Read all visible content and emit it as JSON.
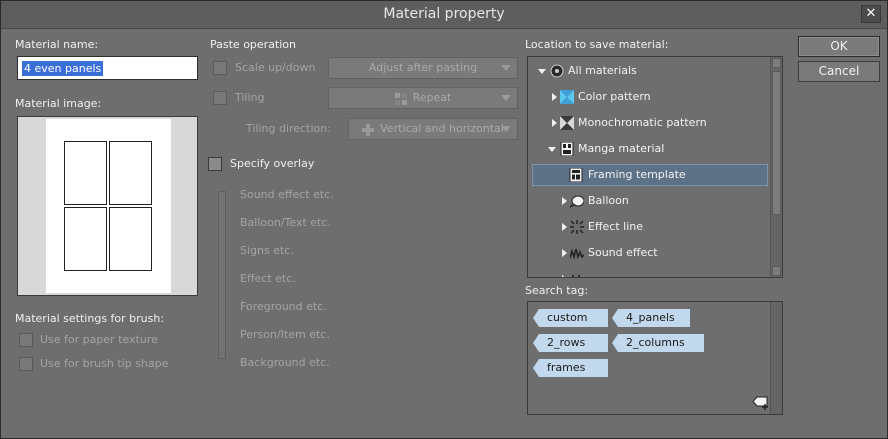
{
  "window": {
    "title": "Material property",
    "close_glyph": "✕"
  },
  "material_name": {
    "label": "Material name:",
    "value": "4 even panels"
  },
  "material_image": {
    "label": "Material image:"
  },
  "brush_settings": {
    "label": "Material settings for brush:",
    "paper_texture": "Use for paper texture",
    "brush_tip": "Use for brush tip shape"
  },
  "paste": {
    "label": "Paste operation",
    "scale_label": "Scale up/down",
    "scale_value": "Adjust after pasting",
    "tiling_label": "Tiling",
    "tiling_value": "Repeat",
    "direction_label": "Tiling direction:",
    "direction_value": "Vertical and horizontal"
  },
  "overlay": {
    "label": "Specify overlay",
    "levels": [
      "Sound effect etc.",
      "Balloon/Text etc.",
      "Signs etc.",
      "Effect etc.",
      "Foreground etc.",
      "Person/Item etc.",
      "Background etc."
    ]
  },
  "location": {
    "label": "Location to save material:",
    "items": [
      {
        "label": "All materials",
        "icon": "disc-icon"
      },
      {
        "label": "Color pattern",
        "icon": "color-pattern-icon"
      },
      {
        "label": "Monochromatic pattern",
        "icon": "mono-pattern-icon"
      },
      {
        "label": "Manga material",
        "icon": "manga-icon"
      },
      {
        "label": "Framing template",
        "icon": "frame-icon"
      },
      {
        "label": "Balloon",
        "icon": "balloon-icon"
      },
      {
        "label": "Effect line",
        "icon": "effect-line-icon"
      },
      {
        "label": "Sound effect",
        "icon": "sound-effect-icon"
      }
    ]
  },
  "search_tag": {
    "label": "Search tag:",
    "tags": [
      "custom",
      "4_panels",
      "2_rows",
      "2_columns",
      "frames"
    ]
  },
  "buttons": {
    "ok": "OK",
    "cancel": "Cancel"
  },
  "colors": {
    "accent": "#5d7287",
    "tag": "#c2d8ec",
    "selection": "#3b6fd8"
  }
}
